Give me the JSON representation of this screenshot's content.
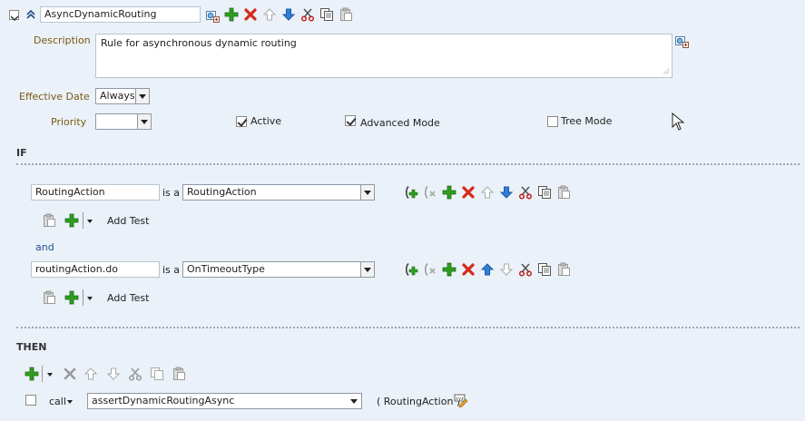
{
  "rule": {
    "name": "AsyncDynamicRouting",
    "description_label": "Description",
    "description": "Rule for asynchronous dynamic routing",
    "effective_date_label": "Effective Date",
    "effective_date": "Always",
    "priority_label": "Priority",
    "priority": "",
    "active_label": "Active",
    "active_checked": true,
    "advanced_label": "Advanced Mode",
    "advanced_checked": true,
    "tree_label": "Tree Mode",
    "tree_checked": false
  },
  "if_section": {
    "heading": "IF",
    "conditions": [
      {
        "variable": "RoutingAction",
        "is_a": "is a",
        "type": "RoutingAction",
        "add_test": "Add Test"
      },
      {
        "variable": "routingAction.do",
        "is_a": "is a",
        "type": "OnTimeoutType",
        "add_test": "Add Test"
      }
    ],
    "conjunction": "and"
  },
  "then_section": {
    "heading": "THEN",
    "action": {
      "kind": "call",
      "function": "assertDynamicRoutingAsync",
      "args": "( RoutingAction )"
    }
  },
  "colors": {
    "background": "#eaf1f8",
    "add_green": "#2e9e1f",
    "delete_red": "#d42a1a",
    "arrow_blue": "#2f7fd6",
    "label_orange": "#7a5a12",
    "label_blue": "#1f4e8c"
  }
}
